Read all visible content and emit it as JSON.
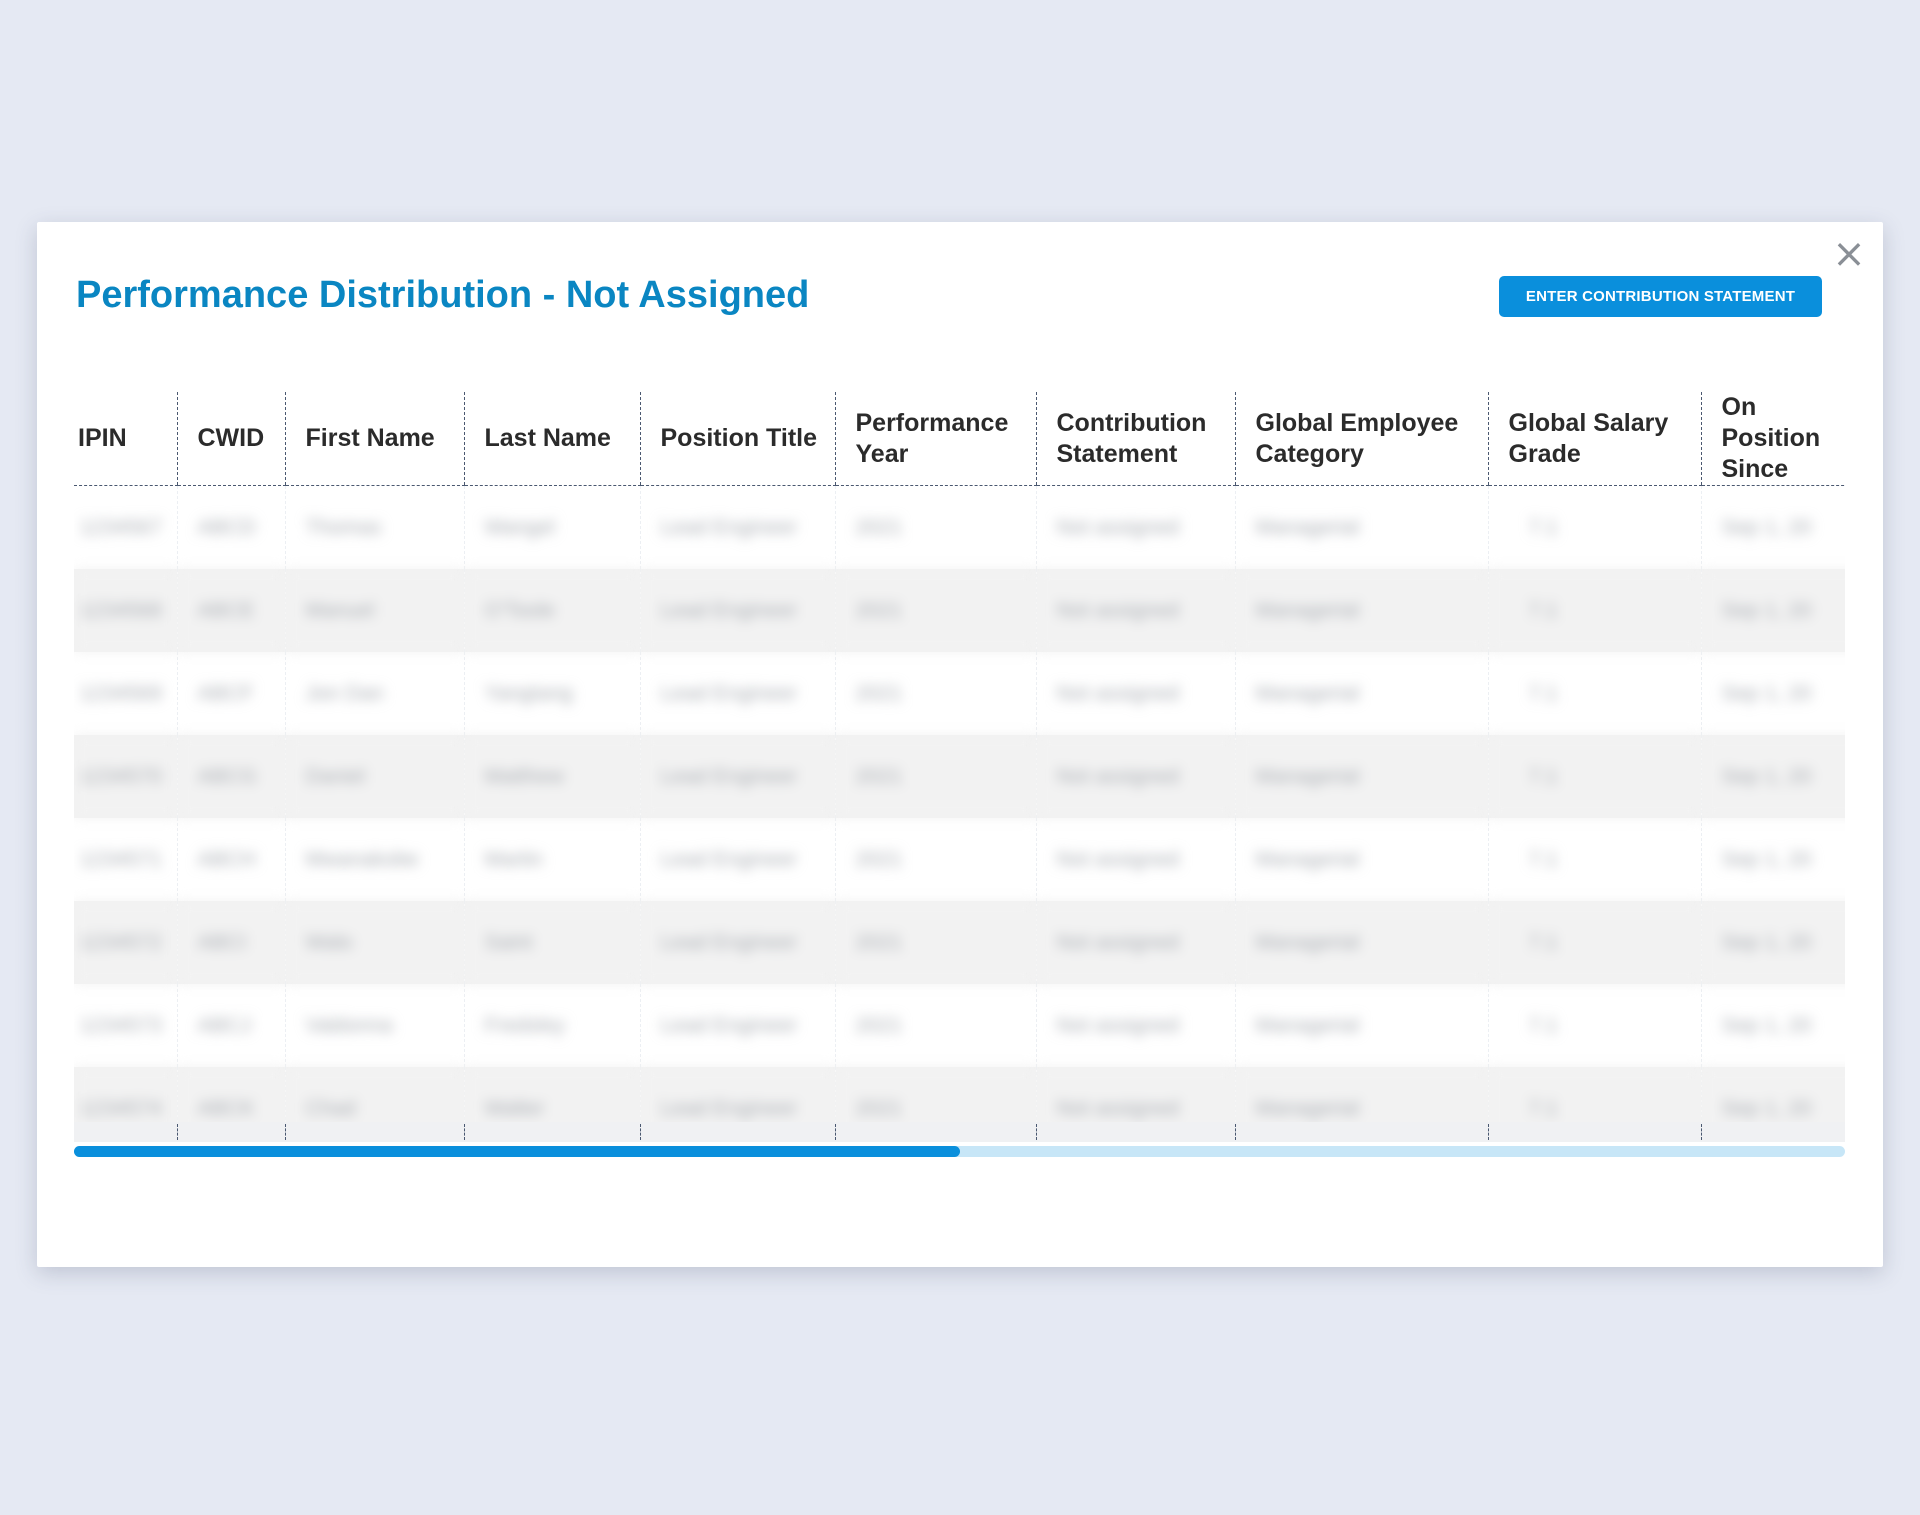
{
  "dialog": {
    "title": "Performance Distribution - Not Assigned",
    "close_symbol": "×",
    "action_button_label": "ENTER CONTRIBUTION STATEMENT"
  },
  "table": {
    "columns": [
      "IPIN",
      "CWID",
      "First Name",
      "Last Name",
      "Position Title",
      "Performance Year",
      "Contribution Statement",
      "Global Employee Category",
      "Global Salary Grade",
      "On Position Since"
    ],
    "rows": [
      [
        "1234567",
        "ABCD",
        "Thomas",
        "Wangel",
        "Lead Engineer",
        "2021",
        "Not assigned",
        "Managerial",
        "7.1",
        "Sep 1, 20"
      ],
      [
        "1234568",
        "ABCE",
        "Manuel",
        "O'Toole",
        "Lead Engineer",
        "2021",
        "Not assigned",
        "Managerial",
        "7.1",
        "Sep 1, 20"
      ],
      [
        "1234569",
        "ABCF",
        "Jon Dan",
        "Yangtang",
        "Lead Engineer",
        "2021",
        "Not assigned",
        "Managerial",
        "7.1",
        "Sep 1, 20"
      ],
      [
        "1234570",
        "ABCG",
        "Daniel",
        "Matthew",
        "Lead Engineer",
        "2021",
        "Not assigned",
        "Managerial",
        "7.1",
        "Sep 1, 20"
      ],
      [
        "1234571",
        "ABCH",
        "Mwanakobe",
        "Martin",
        "Lead Engineer",
        "2021",
        "Not assigned",
        "Managerial",
        "7.1",
        "Sep 1, 20"
      ],
      [
        "1234572",
        "ABCI",
        "Walo",
        "Saint",
        "Lead Engineer",
        "2021",
        "Not assigned",
        "Managerial",
        "7.1",
        "Sep 1, 20"
      ],
      [
        "1234573",
        "ABCJ",
        "Valdonna",
        "Fredsley",
        "Lead Engineer",
        "2021",
        "Not assigned",
        "Managerial",
        "7.1",
        "Sep 1, 20"
      ],
      [
        "1234574",
        "ABCK",
        "Chad",
        "Walter",
        "Lead Engineer",
        "2021",
        "Not assigned",
        "Managerial",
        "7.1",
        "Sep 1, 20"
      ]
    ]
  },
  "scrollbar": {
    "scroll_fraction": 0.5
  }
}
